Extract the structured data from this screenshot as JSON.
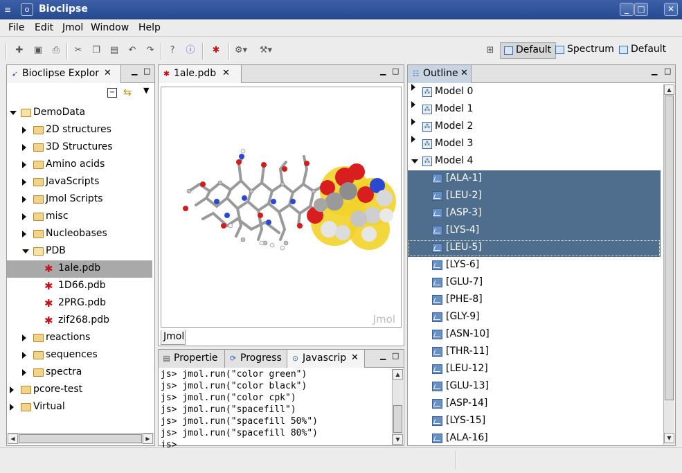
{
  "window": {
    "title": "Bioclipse"
  },
  "menu": [
    "File",
    "Edit",
    "Jmol",
    "Window",
    "Help"
  ],
  "perspectives": [
    {
      "label": "Default",
      "active": true
    },
    {
      "label": "Spectrum",
      "active": false
    },
    {
      "label": "Default",
      "active": false
    }
  ],
  "explorer": {
    "tab_label": "Bioclipse Explor",
    "tree": [
      {
        "label": "DemoData",
        "type": "folder",
        "expanded": true
      },
      {
        "label": "2D structures",
        "type": "folder"
      },
      {
        "label": "3D Structures",
        "type": "folder"
      },
      {
        "label": "Amino acids",
        "type": "folder"
      },
      {
        "label": "JavaScripts",
        "type": "folder"
      },
      {
        "label": "Jmol Scripts",
        "type": "folder"
      },
      {
        "label": "misc",
        "type": "folder"
      },
      {
        "label": "Nucleobases",
        "type": "folder"
      },
      {
        "label": "PDB",
        "type": "folder",
        "expanded": true
      },
      {
        "label": "1ale.pdb",
        "type": "pdb",
        "selected": true
      },
      {
        "label": "1D66.pdb",
        "type": "pdb"
      },
      {
        "label": "2PRG.pdb",
        "type": "pdb"
      },
      {
        "label": "zif268.pdb",
        "type": "pdb"
      },
      {
        "label": "reactions",
        "type": "folder"
      },
      {
        "label": "sequences",
        "type": "folder"
      },
      {
        "label": "spectra",
        "type": "folder"
      },
      {
        "label": "pcore-test",
        "type": "project"
      },
      {
        "label": "Virtual",
        "type": "project"
      }
    ]
  },
  "editor": {
    "tab_label": "1ale.pdb",
    "watermark": "Jmol",
    "bottom_tab": "Jmol"
  },
  "console": {
    "tabs": [
      "Propertie",
      "Progress",
      "Javascrip"
    ],
    "lines": [
      "js> jmol.run(\"color green\")",
      "js> jmol.run(\"color black\")",
      "js> jmol.run(\"color cpk\")",
      "js> jmol.run(\"spacefill\")",
      "js> jmol.run(\"spacefill 50%\")",
      "js> jmol.run(\"spacefill 80%\")",
      "js>"
    ]
  },
  "outline": {
    "tab_label": "Outline",
    "models": [
      "Model 0",
      "Model 1",
      "Model 2",
      "Model 3",
      "Model 4"
    ],
    "residues": [
      {
        "label": "[ALA-1]",
        "selected": true
      },
      {
        "label": "[LEU-2]",
        "selected": true
      },
      {
        "label": "[ASP-3]",
        "selected": true
      },
      {
        "label": "[LYS-4]",
        "selected": true
      },
      {
        "label": "[LEU-5]",
        "selected": true,
        "focused": true
      },
      {
        "label": "[LYS-6]"
      },
      {
        "label": "[GLU-7]"
      },
      {
        "label": "[PHE-8]"
      },
      {
        "label": "[GLY-9]"
      },
      {
        "label": "[ASN-10]"
      },
      {
        "label": "[THR-11]"
      },
      {
        "label": "[LEU-12]"
      },
      {
        "label": "[GLU-13]"
      },
      {
        "label": "[ASP-14]"
      },
      {
        "label": "[LYS-15]"
      },
      {
        "label": "[ALA-16]"
      }
    ]
  }
}
